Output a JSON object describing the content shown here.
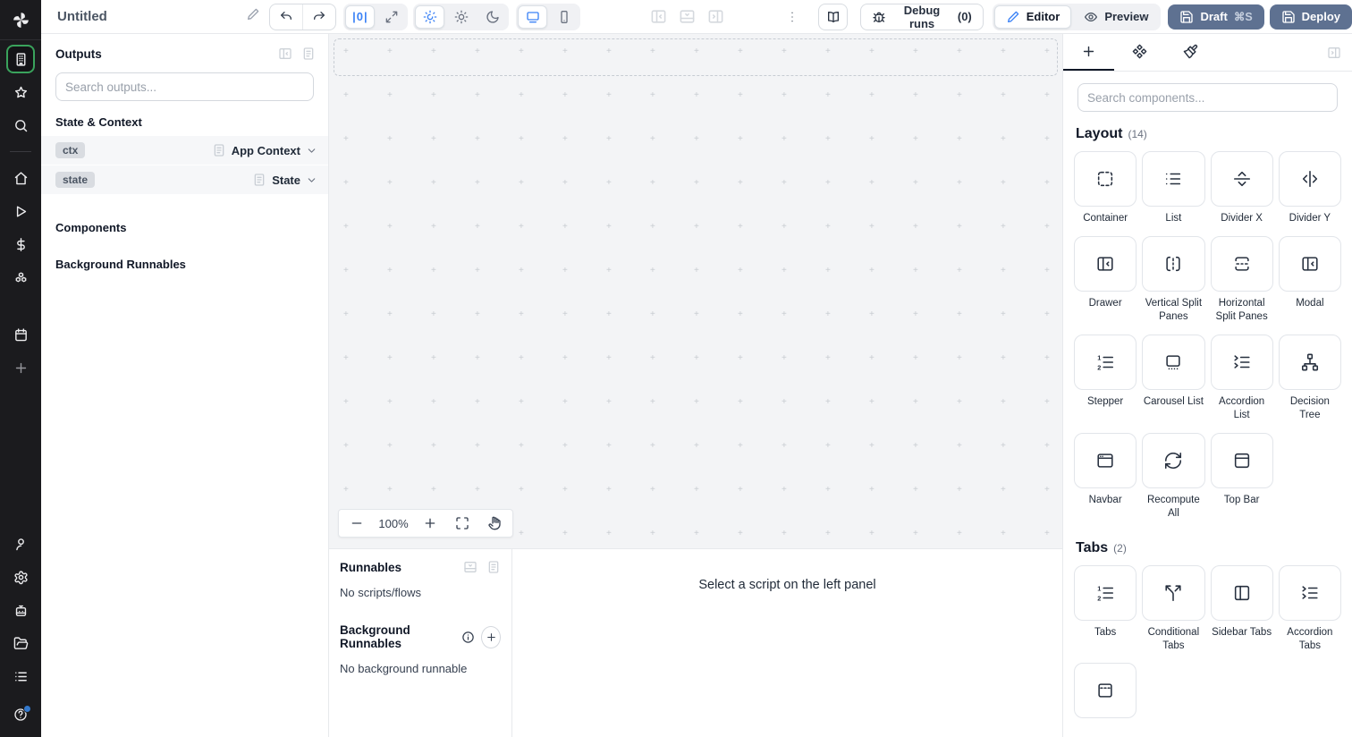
{
  "toolbar": {
    "title": "Untitled",
    "align_glyph": "|0|",
    "debug_runs_label": "Debug runs",
    "debug_runs_count": "(0)",
    "editor_label": "Editor",
    "preview_label": "Preview",
    "draft_label": "Draft",
    "draft_shortcut": "⌘S",
    "deploy_label": "Deploy"
  },
  "sidebar": {
    "top": [
      {
        "name": "app-editor",
        "icon": "building-icon",
        "active": true
      },
      {
        "name": "favorites",
        "icon": "star-icon"
      },
      {
        "name": "search",
        "icon": "search-icon"
      }
    ],
    "nav": [
      {
        "name": "home",
        "icon": "home-icon"
      },
      {
        "name": "runs",
        "icon": "play-icon"
      },
      {
        "name": "variables",
        "icon": "dollar-icon"
      },
      {
        "name": "resources",
        "icon": "resources-icon"
      },
      {
        "name": "schedules",
        "icon": "calendar-icon",
        "gap_before": true
      },
      {
        "name": "more",
        "icon": "plus-icon",
        "dim": true
      }
    ],
    "bottom": [
      {
        "name": "user",
        "icon": "user-icon"
      },
      {
        "name": "settings",
        "icon": "gear-icon"
      },
      {
        "name": "workers",
        "icon": "robot-icon"
      },
      {
        "name": "folders",
        "icon": "folder-icon"
      },
      {
        "name": "logs",
        "icon": "list-icon"
      }
    ],
    "help": {
      "name": "help",
      "icon": "help-icon",
      "notification": true
    }
  },
  "outputs_panel": {
    "title": "Outputs",
    "search_placeholder": "Search outputs...",
    "sections": {
      "state_context": "State & Context",
      "components": "Components",
      "background_runnables": "Background Runnables"
    },
    "rows": [
      {
        "key": "ctx",
        "type": "App Context"
      },
      {
        "key": "state",
        "type": "State"
      }
    ]
  },
  "canvas": {
    "zoom_level": "100%"
  },
  "runnables_panel": {
    "title": "Runnables",
    "empty_scripts": "No scripts/flows",
    "background_title": "Background Runnables",
    "empty_background": "No background runnable",
    "select_hint": "Select a script on the left panel"
  },
  "right_panel": {
    "search_placeholder": "Search components...",
    "sections": [
      {
        "title": "Layout",
        "count": "(14)",
        "items": [
          {
            "label": "Container",
            "icon": "container-icon"
          },
          {
            "label": "List",
            "icon": "list-items-icon"
          },
          {
            "label": "Divider X",
            "icon": "divider-x-icon"
          },
          {
            "label": "Divider Y",
            "icon": "divider-y-icon"
          },
          {
            "label": "Drawer",
            "icon": "drawer-icon"
          },
          {
            "label": "Vertical Split Panes",
            "icon": "vertical-split-icon"
          },
          {
            "label": "Horizontal Split Panes",
            "icon": "horizontal-split-icon"
          },
          {
            "label": "Modal",
            "icon": "modal-icon"
          },
          {
            "label": "Stepper",
            "icon": "stepper-icon"
          },
          {
            "label": "Carousel List",
            "icon": "carousel-icon"
          },
          {
            "label": "Accordion List",
            "icon": "accordion-icon"
          },
          {
            "label": "Decision Tree",
            "icon": "decision-tree-icon"
          },
          {
            "label": "Navbar",
            "icon": "navbar-icon"
          },
          {
            "label": "Recompute All",
            "icon": "recompute-icon"
          },
          {
            "label": "Top Bar",
            "icon": "topbar-icon"
          }
        ]
      },
      {
        "title": "Tabs",
        "count": "(2)",
        "items": [
          {
            "label": "Tabs",
            "icon": "tabs-icon"
          },
          {
            "label": "Conditional Tabs",
            "icon": "conditional-tabs-icon"
          },
          {
            "label": "Sidebar Tabs",
            "icon": "sidebar-tabs-icon"
          },
          {
            "label": "Accordion Tabs",
            "icon": "accordion-icon"
          },
          {
            "label": "",
            "icon": "invisible-tabs-icon"
          }
        ]
      }
    ]
  },
  "colors": {
    "accent_blue": "#3b82f6",
    "cta_slate": "#5e7191",
    "sidebar_bg": "#1b1b1e",
    "active_green": "#3aa35c",
    "canvas_bg": "#f3f4f6"
  }
}
